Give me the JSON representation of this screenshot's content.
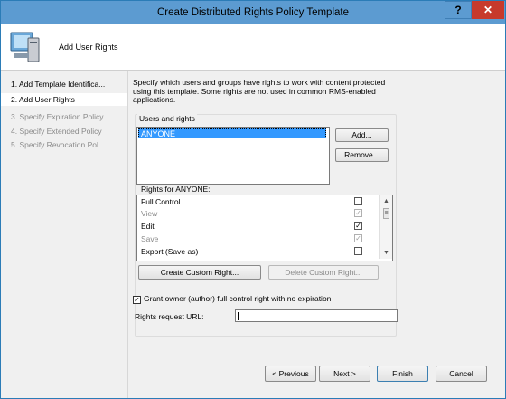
{
  "window": {
    "title": "Create Distributed Rights Policy Template",
    "help": "?",
    "close": "✕"
  },
  "header": {
    "title": "Add User Rights",
    "icon": "computer-icon"
  },
  "steps": [
    {
      "label": "1. Add Template Identifica...",
      "state": "done"
    },
    {
      "label": "2. Add User Rights",
      "state": "current"
    },
    {
      "label": "3. Specify Expiration Policy",
      "state": "pending"
    },
    {
      "label": "4. Specify Extended Policy",
      "state": "pending"
    },
    {
      "label": "5. Specify Revocation Pol...",
      "state": "pending"
    }
  ],
  "description": "Specify which users and groups have rights to work with content protected using this template. Some rights are not used in common RMS-enabled applications.",
  "users_group": {
    "label": "Users and rights",
    "users": [
      "ANYONE"
    ],
    "add_label": "Add...",
    "remove_label": "Remove..."
  },
  "rights": {
    "label": "Rights for ANYONE:",
    "items": [
      {
        "name": "Full Control",
        "checked": false,
        "enabled": true
      },
      {
        "name": "View",
        "checked": true,
        "enabled": false
      },
      {
        "name": "Edit",
        "checked": true,
        "enabled": true
      },
      {
        "name": "Save",
        "checked": true,
        "enabled": false
      },
      {
        "name": "Export (Save as)",
        "checked": false,
        "enabled": true
      }
    ],
    "create_label": "Create Custom Right...",
    "delete_label": "Delete Custom Right..."
  },
  "grant": {
    "label": "Grant owner (author) full control right with no expiration",
    "checked": true
  },
  "url": {
    "label": "Rights request URL:",
    "value": ""
  },
  "footer": {
    "previous": "< Previous",
    "next": "Next >",
    "finish": "Finish",
    "cancel": "Cancel"
  },
  "colors": {
    "titlebar": "#5c9bd1",
    "close": "#c73a2c",
    "selection": "#3399ff"
  }
}
